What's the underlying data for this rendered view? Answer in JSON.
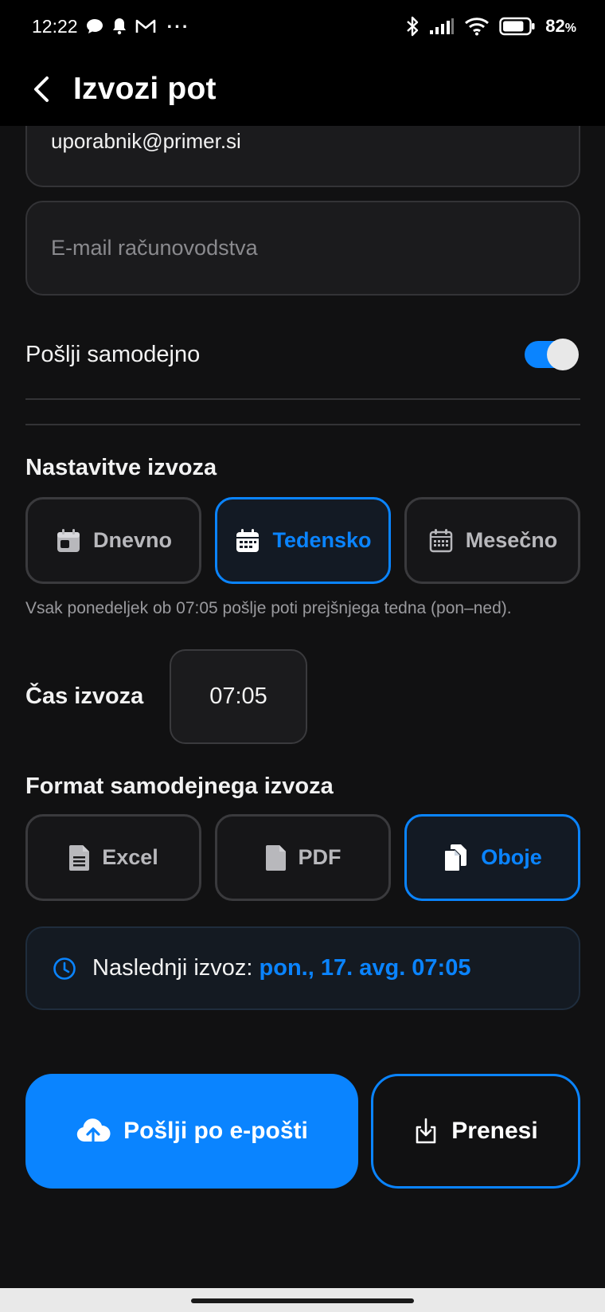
{
  "status_bar": {
    "time": "12:22",
    "battery_percent": "82",
    "battery_suffix": "%",
    "battery_level": 0.82,
    "overflow": "···"
  },
  "app_bar": {
    "title": "Izvozi pot"
  },
  "form": {
    "email_value": "uporabnik@primer.si",
    "accounting_placeholder": "E-mail računovodstva",
    "auto_send_label": "Pošlji samodejno",
    "auto_send_on": true
  },
  "export_settings": {
    "title": "Nastavitve izvoza",
    "options": [
      "Dnevno",
      "Tedensko",
      "Mesečno"
    ],
    "selected": "Tedensko",
    "hint": "Vsak ponedeljek ob 07:05 pošlje poti prejšnjega tedna (pon–ned)."
  },
  "export_time": {
    "label": "Čas izvoza",
    "value": "07:05"
  },
  "format": {
    "title": "Format samodejnega izvoza",
    "options": [
      "Excel",
      "PDF",
      "Oboje"
    ],
    "selected": "Oboje"
  },
  "next_export": {
    "label": "Naslednji izvoz: ",
    "value": "pon., 17. avg. 07:05"
  },
  "actions": {
    "send_email": "Pošlji po e-pošti",
    "download": "Prenesi"
  },
  "colors": {
    "accent": "#0a84ff",
    "background": "#111112",
    "surface": "#1b1b1d"
  },
  "icons": {
    "back": "chevron-left-icon",
    "daily": "calendar-day-icon",
    "weekly": "calendar-week-icon",
    "monthly": "calendar-month-icon",
    "excel": "spreadsheet-file-icon",
    "pdf": "file-icon",
    "both": "copy-files-icon",
    "clock": "clock-icon",
    "upload": "cloud-upload-icon",
    "download": "download-icon"
  }
}
